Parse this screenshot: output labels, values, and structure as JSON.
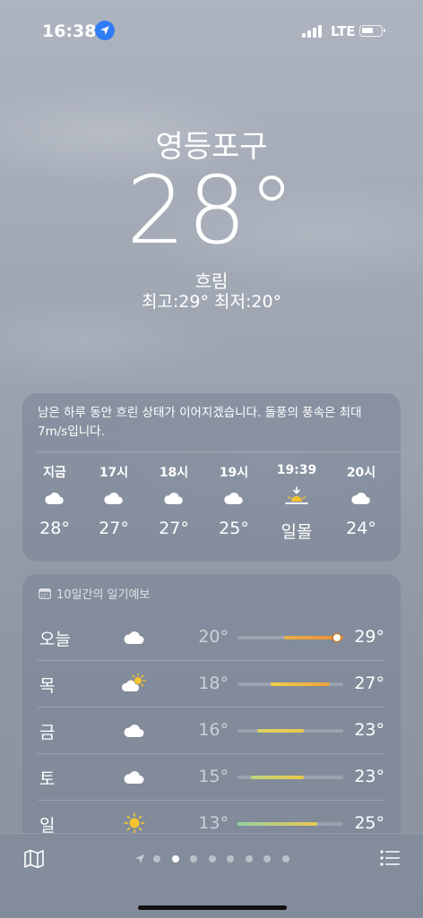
{
  "status": {
    "time": "16:38",
    "network": "LTE",
    "icons": [
      "location-arrow-icon",
      "signal-icon",
      "battery-icon"
    ]
  },
  "hero": {
    "city": "영등포구",
    "temperature": "28°",
    "condition": "흐림",
    "hilo": "최고:29°  최저:20°"
  },
  "hourly": {
    "summary": "남은 하루 동안 흐린 상태가 이어지겠습니다. 돌풍의 풍속은 최대 7m/s입니다.",
    "items": [
      {
        "label": "지금",
        "icon": "cloud-icon",
        "value": "28°"
      },
      {
        "label": "17시",
        "icon": "cloud-icon",
        "value": "27°"
      },
      {
        "label": "18시",
        "icon": "cloud-icon",
        "value": "27°"
      },
      {
        "label": "19시",
        "icon": "cloud-icon",
        "value": "25°"
      },
      {
        "label": "19:39",
        "icon": "sunset-icon",
        "value": "일몰"
      },
      {
        "label": "20시",
        "icon": "cloud-icon",
        "value": "24°"
      }
    ]
  },
  "daily": {
    "header": "10일간의 일기예보",
    "header_icon": "calendar-icon",
    "range": [
      13,
      29
    ],
    "items": [
      {
        "day": "오늘",
        "icon": "cloud-icon",
        "low": "20°",
        "high": "29°",
        "low_val": 20,
        "high_val": 29,
        "current": 28,
        "bar_colors": [
          "#e7b045",
          "#ef8a3a"
        ]
      },
      {
        "day": "목",
        "icon": "partly-sunny-icon",
        "low": "18°",
        "high": "27°",
        "low_val": 18,
        "high_val": 27,
        "bar_colors": [
          "#f0cf4a",
          "#eea23d"
        ]
      },
      {
        "day": "금",
        "icon": "cloud-icon",
        "low": "16°",
        "high": "23°",
        "low_val": 16,
        "high_val": 23,
        "bar_colors": [
          "#d9d265",
          "#ecc84a"
        ]
      },
      {
        "day": "토",
        "icon": "cloud-icon",
        "low": "15°",
        "high": "23°",
        "low_val": 15,
        "high_val": 23,
        "bar_colors": [
          "#bfd57a",
          "#ecc84a"
        ]
      },
      {
        "day": "일",
        "icon": "sun-icon",
        "low": "13°",
        "high": "25°",
        "low_val": 13,
        "high_val": 25,
        "bar_colors": [
          "#93d3a6",
          "#ecc84a"
        ]
      }
    ]
  },
  "bottom": {
    "pages": 8,
    "active_page": 1,
    "icons": [
      "map-icon",
      "location-arrow-icon",
      "list-icon"
    ]
  }
}
